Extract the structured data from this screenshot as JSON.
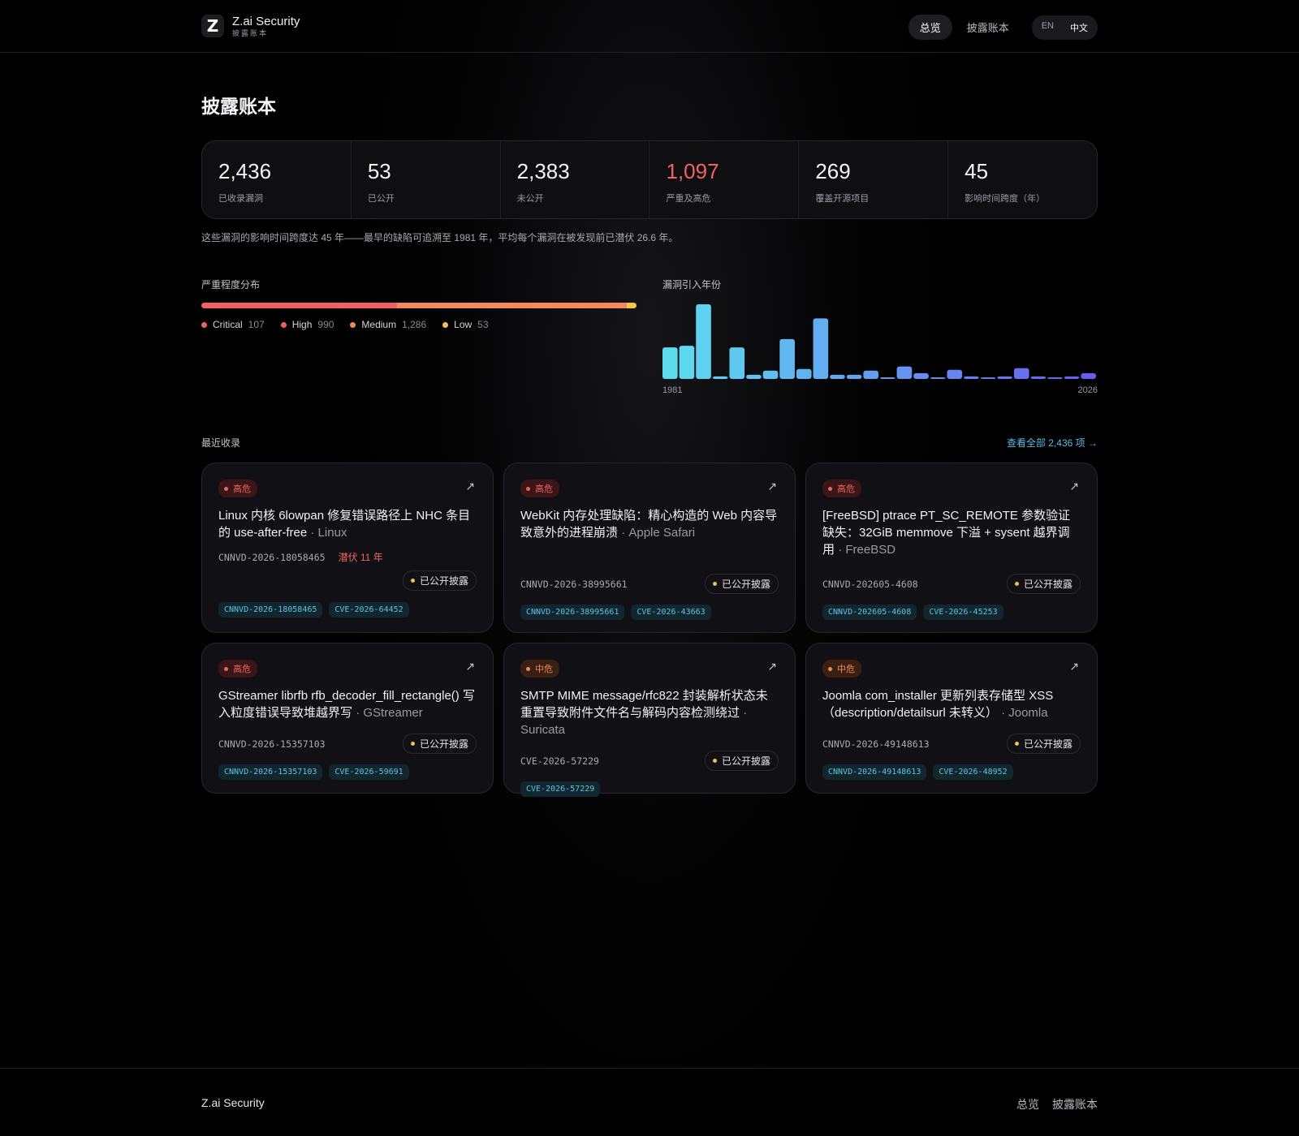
{
  "header": {
    "logo_glyph": "Z",
    "brand_name": "Z.ai Security",
    "brand_sub": "披露账本",
    "nav": [
      "总览",
      "披露账本"
    ],
    "lang": [
      "EN",
      "中文"
    ]
  },
  "page": {
    "title": "披露账本",
    "summary": "这些漏洞的影响时间跨度达 45 年——最早的缺陷可追溯至 1981 年，平均每个漏洞在被发现前已潜伏 26.6 年。"
  },
  "stats": [
    {
      "value": "2,436",
      "label": "已收录漏洞"
    },
    {
      "value": "53",
      "label": "已公开"
    },
    {
      "value": "2,383",
      "label": "未公开"
    },
    {
      "value": "1,097",
      "label": "严重及高危",
      "accent": "#f06363"
    },
    {
      "value": "269",
      "label": "覆盖开源项目"
    },
    {
      "value": "45",
      "label": "影响时间跨度（年）"
    }
  ],
  "severity": {
    "label": "严重程度分布",
    "items": [
      {
        "name": "Critical",
        "count": "107",
        "value": 107,
        "color": "#f26060"
      },
      {
        "name": "High",
        "count": "990",
        "value": 990,
        "color": "#f06060"
      },
      {
        "name": "Medium",
        "count": "1,286",
        "value": 1286,
        "color": "#f28a5a"
      },
      {
        "name": "Low",
        "count": "53",
        "value": 53,
        "color": "#f4c548"
      }
    ]
  },
  "chart_data": {
    "type": "bar",
    "title": "漏洞引入年份",
    "x_start_label": "1981",
    "x_end_label": "2026",
    "values": [
      38,
      40,
      90,
      3,
      38,
      5,
      10,
      48,
      12,
      73,
      5,
      5,
      10,
      2,
      15,
      7,
      2,
      11,
      3,
      2,
      3,
      13,
      3,
      2,
      3,
      7
    ],
    "color_start": "#5ddcf0",
    "color_end": "#6a5cf0"
  },
  "recent": {
    "label": "最近收录",
    "view_all": "查看全部 2,436 项 →",
    "cards": [
      {
        "badge": "高危",
        "level": "high",
        "title": "Linux 内核 6lowpan 修复错误路径上 NHC 条目的 use-after-free",
        "product": "· Linux",
        "id": "CNNVD-2026-18058465",
        "latent": "潜伏 11 年",
        "status": "已公开披露",
        "tags": [
          "CNNVD-2026-18058465",
          "CVE-2026-64452"
        ]
      },
      {
        "badge": "高危",
        "level": "high",
        "title": "WebKit 内存处理缺陷：精心构造的 Web 内容导致意外的进程崩溃",
        "product": "· Apple Safari",
        "id": "CNNVD-2026-38995661",
        "latent": "",
        "status": "已公开披露",
        "tags": [
          "CNNVD-2026-38995661",
          "CVE-2026-43663"
        ]
      },
      {
        "badge": "高危",
        "level": "high",
        "title": "[FreeBSD] ptrace PT_SC_REMOTE 参数验证缺失：32GiB memmove 下溢 + sysent 越界调用",
        "product": "· FreeBSD",
        "id": "CNNVD-202605-4608",
        "latent": "",
        "status": "已公开披露",
        "tags": [
          "CNNVD-202605-4608",
          "CVE-2026-45253"
        ]
      },
      {
        "badge": "高危",
        "level": "high",
        "title": "GStreamer librfb rfb_decoder_fill_rectangle() 写入粒度错误导致堆越界写",
        "product": "· GStreamer",
        "id": "CNNVD-2026-15357103",
        "latent": "",
        "status": "已公开披露",
        "tags": [
          "CNNVD-2026-15357103",
          "CVE-2026-59691"
        ]
      },
      {
        "badge": "中危",
        "level": "med",
        "title": "SMTP MIME message/rfc822 封装解析状态未重置导致附件文件名与解码内容检测绕过",
        "product": "· Suricata",
        "id": "CVE-2026-57229",
        "latent": "",
        "status": "已公开披露",
        "tags": [
          "CVE-2026-57229"
        ]
      },
      {
        "badge": "中危",
        "level": "med",
        "title": "Joomla com_installer 更新列表存储型 XSS （description/detailsurl 未转义）",
        "product": "· Joomla",
        "id": "CNNVD-2026-49148613",
        "latent": "",
        "status": "已公开披露",
        "tags": [
          "CNNVD-2026-49148613",
          "CVE-2026-48952"
        ]
      }
    ]
  },
  "footer": {
    "brand": "Z.ai Security",
    "links": [
      "总览",
      "披露账本"
    ]
  }
}
